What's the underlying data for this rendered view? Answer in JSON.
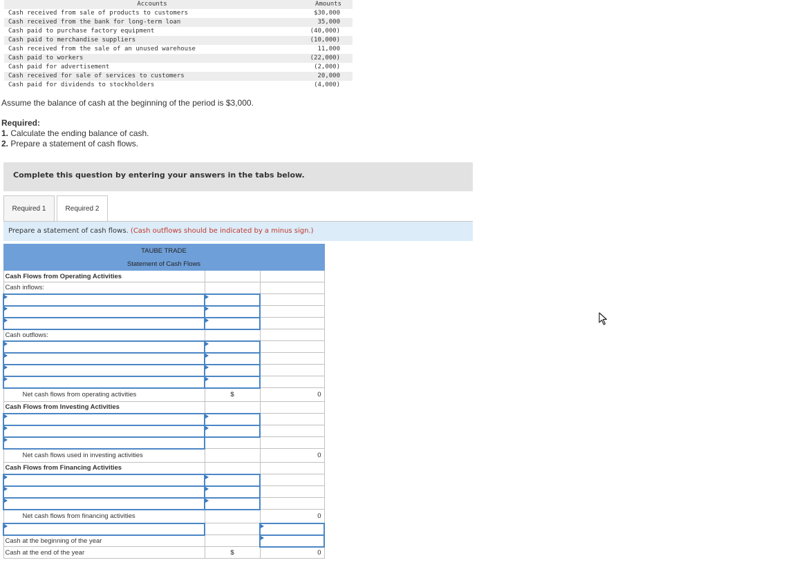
{
  "accounts_table": {
    "header_accounts": "Accounts",
    "header_amounts": "Amounts",
    "rows": [
      {
        "account": "Cash received from sale of products to customers",
        "amount": "$30,000"
      },
      {
        "account": "Cash received from the bank for long-term loan",
        "amount": "35,000"
      },
      {
        "account": "Cash paid to purchase factory equipment",
        "amount": "(40,000)"
      },
      {
        "account": "Cash paid to merchandise suppliers",
        "amount": "(10,000)"
      },
      {
        "account": "Cash received from the sale of an unused warehouse",
        "amount": "11,000"
      },
      {
        "account": "Cash paid to workers",
        "amount": "(22,000)"
      },
      {
        "account": "Cash paid for advertisement",
        "amount": "(2,000)"
      },
      {
        "account": "Cash received for sale of services to customers",
        "amount": "20,000"
      },
      {
        "account": "Cash paid for dividends to stockholders",
        "amount": "(4,000)"
      }
    ]
  },
  "assume_text": "Assume the balance of cash at the beginning of the period is $3,000.",
  "required_heading": "Required:",
  "required_1_num": "1.",
  "required_1_text": "Calculate the ending balance of cash.",
  "required_2_num": "2.",
  "required_2_text": "Prepare a statement of cash flows.",
  "complete_banner": "Complete this question by entering your answers in the tabs below.",
  "tabs": [
    "Required 1",
    "Required 2"
  ],
  "instruction": "Prepare a statement of cash flows.",
  "instruction_note": "(Cash outflows should be indicated by a minus sign.)",
  "statement": {
    "company": "TAUBE TRADE",
    "title": "Statement of Cash Flows",
    "operating_heading": "Cash Flows from Operating Activities",
    "cash_inflows": "Cash inflows:",
    "cash_outflows": "Cash outflows:",
    "net_operating": "Net cash flows from operating activities",
    "net_operating_dollar": "$",
    "net_operating_value": "0",
    "investing_heading": "Cash Flows from Investing Activities",
    "net_investing": "Net cash flows used in investing activities",
    "net_investing_value": "0",
    "financing_heading": "Cash Flows from Financing Activities",
    "net_financing": "Net cash flows from financing activities",
    "net_financing_value": "0",
    "beginning_cash": "Cash at the beginning of the year",
    "ending_cash": "Cash at the end of the year",
    "ending_dollar": "$",
    "ending_value": "0"
  }
}
